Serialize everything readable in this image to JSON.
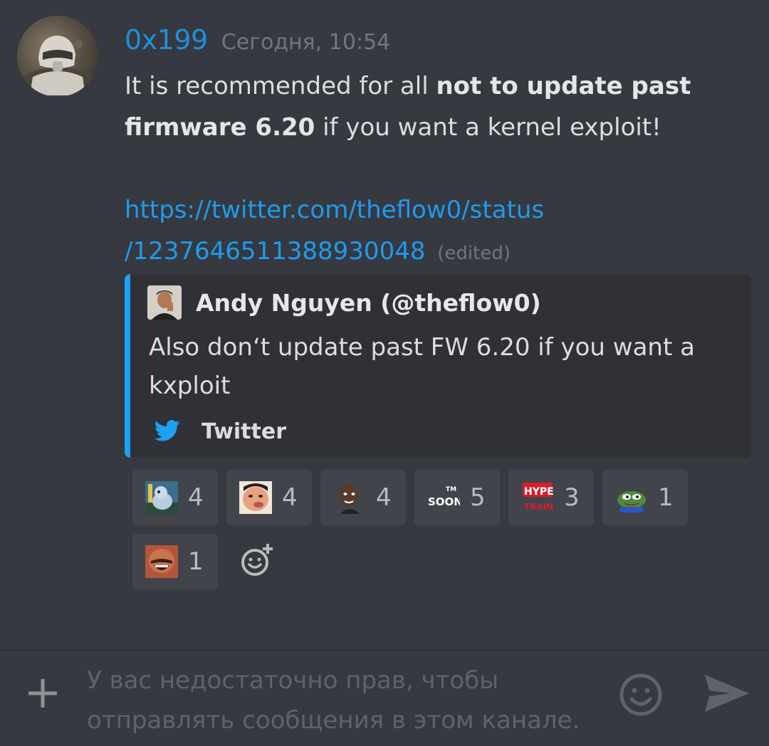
{
  "message": {
    "username": "0x199",
    "timestamp": "Сегодня, 10:54",
    "body_part1": "It is recommended for all ",
    "body_bold": "not to update past firmware 6.20",
    "body_part2": " if you want a kernel exploit!",
    "link_line1": "https://twitter.com/theflow0/status",
    "link_line2": "/1237646511388930048",
    "edited_label": "(edited)"
  },
  "embed": {
    "accent_color": "#1da1f2",
    "author_name": "Andy Nguyen (@theflow0)",
    "description": "Also don‘t update past FW 6.20 if you want a kxploit",
    "footer_text": "Twitter",
    "footer_icon": "twitter-bird-icon"
  },
  "reactions": [
    {
      "emoji": "pokemon-figure-emoji",
      "count": "4"
    },
    {
      "emoji": "smirk-face-emoji",
      "count": "4"
    },
    {
      "emoji": "thinking-man-emoji",
      "count": "4"
    },
    {
      "emoji": "soon-tm-emoji",
      "count": "5",
      "emoji_text": "SOON",
      "emoji_tm": "TM"
    },
    {
      "emoji": "hype-train-emoji",
      "count": "3",
      "emoji_text_top": "HYPE",
      "emoji_text_bottom": "TRAIN"
    },
    {
      "emoji": "pepe-frog-emoji",
      "count": "1"
    },
    {
      "emoji": "laughing-man-emoji",
      "count": "1"
    }
  ],
  "composer": {
    "placeholder": "У вас недостаточно прав, чтобы отправлять сообщения в этом канале."
  },
  "colors": {
    "background": "#36393f",
    "username": "#1e8fdb",
    "link": "#1e9bf0",
    "muted": "#72767d"
  }
}
